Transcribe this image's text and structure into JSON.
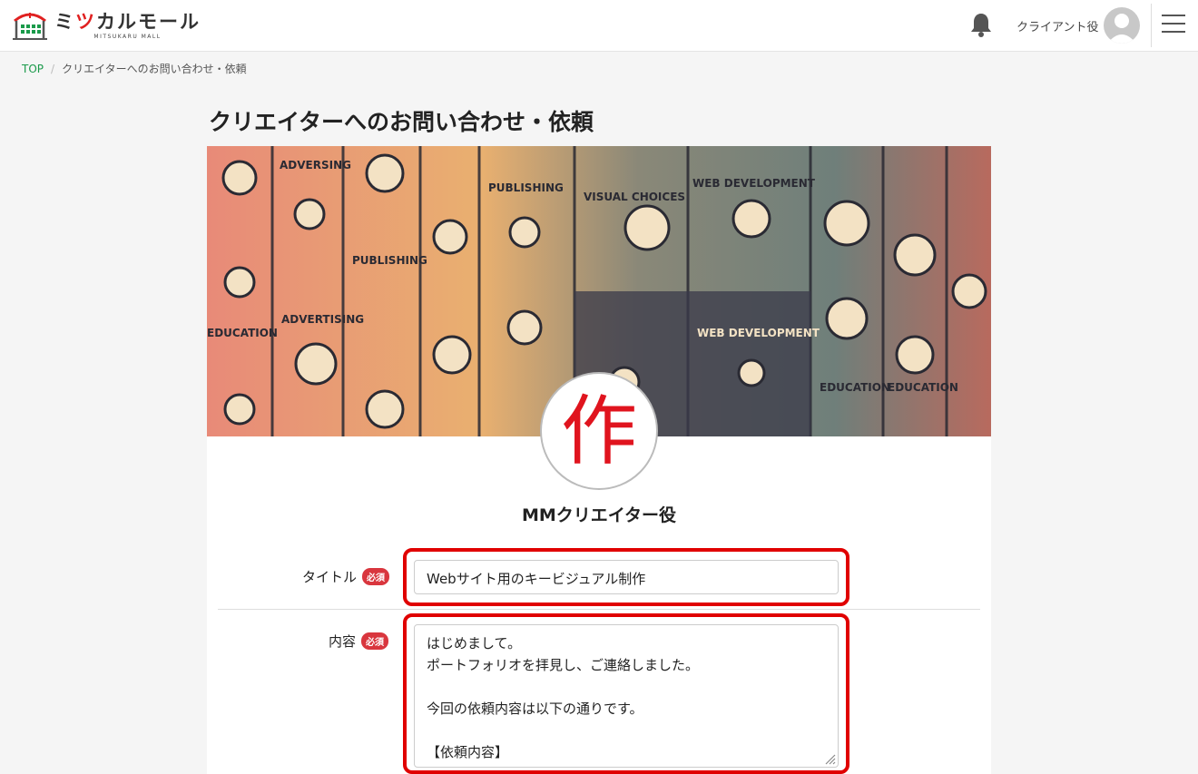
{
  "header": {
    "logo_text": "ミツカルモール",
    "logo_text_accent": "ツ",
    "logo_sub": "MITSUKARU MALL",
    "bell_icon": "bell-icon",
    "user_name": "クライアント役",
    "avatar_icon": "user-avatar-icon",
    "menu_icon": "hamburger-menu-icon"
  },
  "breadcrumb": {
    "top": "TOP",
    "separator": "/",
    "current": "クリエイターへのお問い合わせ・依頼"
  },
  "page": {
    "title": "クリエイターへのお問い合わせ・依頼"
  },
  "banner": {
    "labels": [
      "ADVERSING",
      "PUBLISHING",
      "VISUAL CHOICES",
      "WEB DEVELOPMENT",
      "EDUCATION",
      "ADVERTISING",
      "WEB DEVELOPMENT",
      "EDUCATION",
      "PUBLISHING",
      "EDUCATION"
    ]
  },
  "creator": {
    "avatar_char": "作",
    "name": "MMクリエイター役"
  },
  "form": {
    "title_label": "タイトル",
    "required": "必須",
    "title_value": "Webサイト用のキービジュアル制作",
    "content_label": "内容",
    "content_value": "はじめまして。\nポートフォリオを拝見し、ご連絡しました。\n\n今回の依頼内容は以下の通りです。\n\n【依頼内容】\n・用途：Webサイトのキービジュアル"
  },
  "colors": {
    "accent_red": "#e02020",
    "link_green": "#1a9a4a",
    "required_badge": "#d9363e",
    "highlight": "#e00000"
  }
}
